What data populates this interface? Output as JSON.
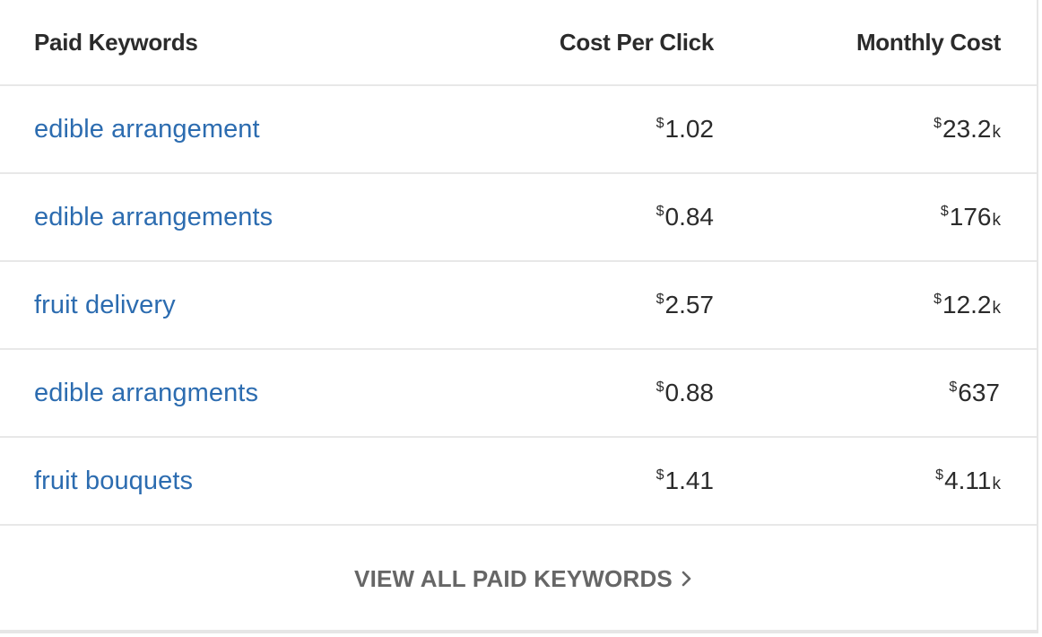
{
  "table": {
    "headers": {
      "keyword": "Paid Keywords",
      "cpc": "Cost Per Click",
      "monthly": "Monthly Cost"
    },
    "currency_symbol": "$",
    "rows": [
      {
        "keyword": "edible arrangement",
        "cpc": "1.02",
        "monthly": "23.2",
        "monthly_suffix": "k"
      },
      {
        "keyword": "edible arrangements",
        "cpc": "0.84",
        "monthly": "176",
        "monthly_suffix": "k"
      },
      {
        "keyword": "fruit delivery",
        "cpc": "2.57",
        "monthly": "12.2",
        "monthly_suffix": "k"
      },
      {
        "keyword": "edible arrangments",
        "cpc": "0.88",
        "monthly": "637",
        "monthly_suffix": ""
      },
      {
        "keyword": "fruit bouquets",
        "cpc": "1.41",
        "monthly": "4.11",
        "monthly_suffix": "k"
      }
    ]
  },
  "footer": {
    "view_all_label": "VIEW ALL PAID KEYWORDS",
    "icon": "chevron-right-icon"
  },
  "colors": {
    "link": "#2c6cb0",
    "header_text": "#2b2b2b",
    "footer_text": "#666666",
    "divider": "#e8e8e8"
  }
}
